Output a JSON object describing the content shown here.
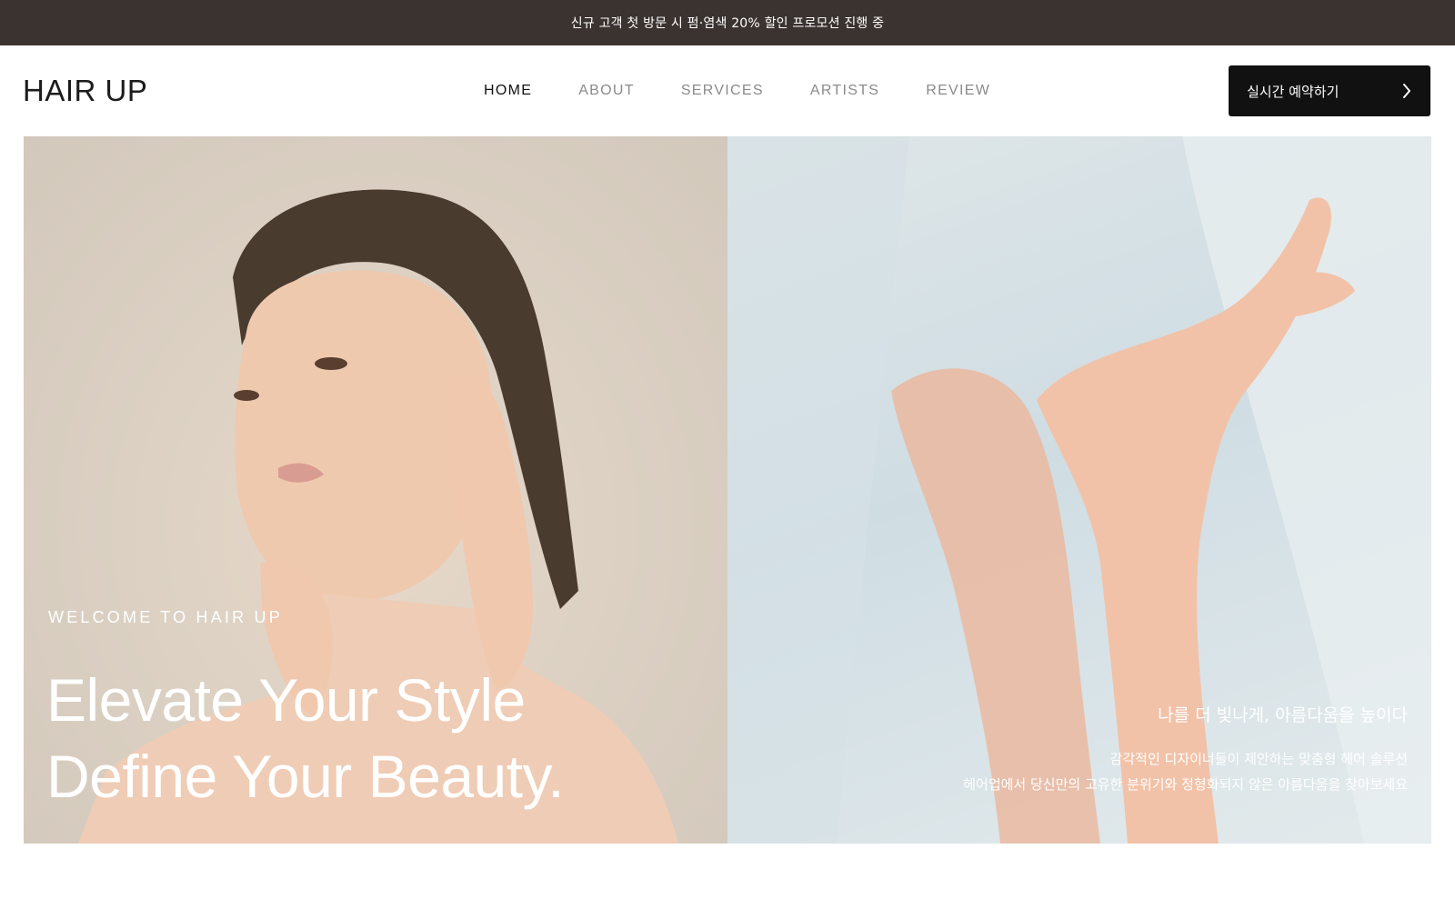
{
  "promo": {
    "text": "신규 고객 첫 방문 시 펌·염색 20% 할인 프로모션 진행 중"
  },
  "header": {
    "logo": "HAIR UP",
    "nav": [
      {
        "label": "HOME",
        "active": true
      },
      {
        "label": "ABOUT",
        "active": false
      },
      {
        "label": "SERVICES",
        "active": false
      },
      {
        "label": "ARTISTS",
        "active": false
      },
      {
        "label": "REVIEW",
        "active": false
      }
    ],
    "reserve_button": {
      "label": "실시간 예약하기",
      "icon": "chevron-right-icon"
    }
  },
  "hero": {
    "welcome": "WELCOME TO HAIR UP",
    "headline_line1": "Elevate Your Style",
    "headline_line2": "Define Your Beauty.",
    "tagline": "나를 더 빛나게, 아름다움을 높이다",
    "description_line1": "감각적인 디자이너들이 제안하는 맞춤형 헤어 솔루션",
    "description_line2": "헤어업에서 당신만의 고유한 분위기와 정형화되지 않은 아름다움을 찾아보세요"
  },
  "colors": {
    "promo_bg": "#3b3330",
    "button_bg": "#111111",
    "nav_active": "#111111",
    "nav_inactive": "#8a8a8a"
  }
}
